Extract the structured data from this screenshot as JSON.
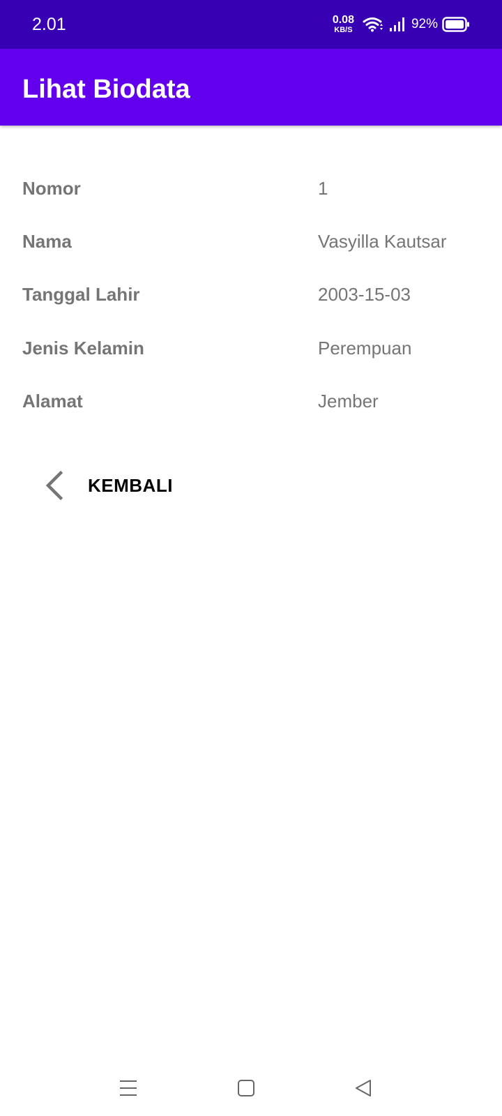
{
  "status_bar": {
    "time": "2.01",
    "net_speed_value": "0.08",
    "net_speed_unit": "KB/S",
    "battery_percent": "92%",
    "icons": [
      "wifi-icon",
      "cellular-signal-icon",
      "battery-icon"
    ]
  },
  "app_bar": {
    "title": "Lihat Biodata",
    "color": "#6200ee",
    "status_color": "#3700b3"
  },
  "biodata": [
    {
      "label": "Nomor",
      "value": "1"
    },
    {
      "label": "Nama",
      "value": "Vasyilla Kautsar"
    },
    {
      "label": "Tanggal Lahir",
      "value": "2003-15-03"
    },
    {
      "label": "Jenis Kelamin",
      "value": "Perempuan"
    },
    {
      "label": "Alamat",
      "value": "Jember"
    }
  ],
  "back_button": {
    "label": "KEMBALI",
    "icon": "chevron-left-icon"
  },
  "nav_bar": {
    "icons": [
      "menu-icon",
      "home-icon",
      "back-triangle-icon"
    ]
  }
}
